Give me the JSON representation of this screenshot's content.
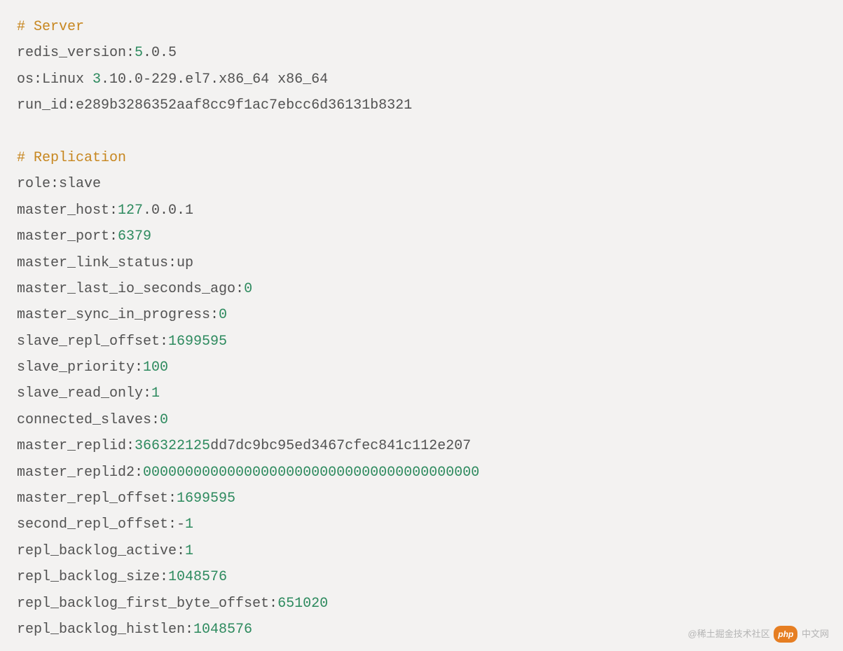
{
  "sections": {
    "server": {
      "header": "# Server",
      "lines": [
        {
          "prefix": "redis_version:",
          "num": "5",
          "suffix": ".0.5"
        },
        {
          "prefix": "os:Linux ",
          "num": "3",
          "suffix": ".10.0-229.el7.x86_64 x86_64"
        },
        {
          "prefix": "run_id:e289b3286352aaf8cc9f1ac7ebcc6d36131b8321",
          "num": "",
          "suffix": ""
        }
      ]
    },
    "replication": {
      "header": "# Replication",
      "lines": [
        {
          "prefix": "role:slave",
          "num": "",
          "suffix": ""
        },
        {
          "prefix": "master_host:",
          "num": "127",
          "suffix": ".0.0.1"
        },
        {
          "prefix": "master_port:",
          "num": "6379",
          "suffix": ""
        },
        {
          "prefix": "master_link_status:up",
          "num": "",
          "suffix": ""
        },
        {
          "prefix": "master_last_io_seconds_ago:",
          "num": "0",
          "suffix": ""
        },
        {
          "prefix": "master_sync_in_progress:",
          "num": "0",
          "suffix": ""
        },
        {
          "prefix": "slave_repl_offset:",
          "num": "1699595",
          "suffix": ""
        },
        {
          "prefix": "slave_priority:",
          "num": "100",
          "suffix": ""
        },
        {
          "prefix": "slave_read_only:",
          "num": "1",
          "suffix": ""
        },
        {
          "prefix": "connected_slaves:",
          "num": "0",
          "suffix": ""
        },
        {
          "prefix": "master_replid:",
          "num": "366322125",
          "suffix": "dd7dc9bc95ed3467cfec841c112e207"
        },
        {
          "prefix": "master_replid2:",
          "num": "0000000000000000000000000000000000000000",
          "suffix": ""
        },
        {
          "prefix": "master_repl_offset:",
          "num": "1699595",
          "suffix": ""
        },
        {
          "prefix": "second_repl_offset:-",
          "num": "1",
          "suffix": ""
        },
        {
          "prefix": "repl_backlog_active:",
          "num": "1",
          "suffix": ""
        },
        {
          "prefix": "repl_backlog_size:",
          "num": "1048576",
          "suffix": ""
        },
        {
          "prefix": "repl_backlog_first_byte_offset:",
          "num": "651020",
          "suffix": ""
        },
        {
          "prefix": "repl_backlog_histlen:",
          "num": "1048576",
          "suffix": ""
        }
      ]
    }
  },
  "watermark": {
    "left": "@稀土掘金技术社区",
    "badge": "php",
    "right": "中文网"
  }
}
